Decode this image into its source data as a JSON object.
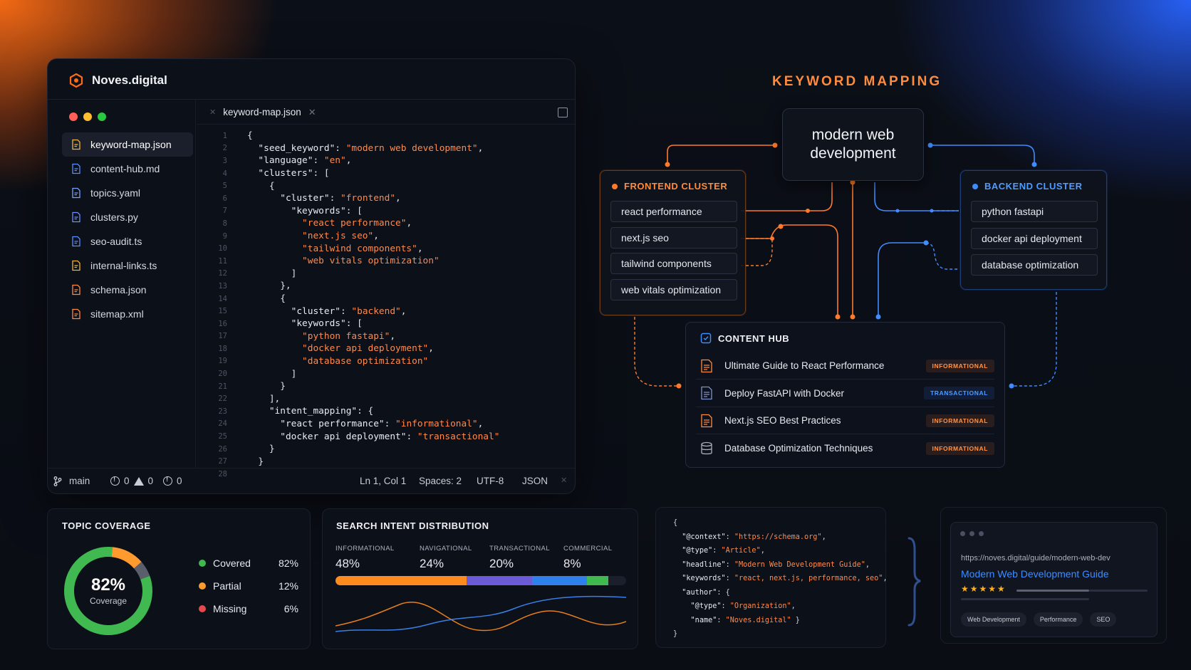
{
  "window": {
    "brand": "Noves.digital"
  },
  "sidebar": {
    "files": [
      {
        "name": "keyword-map.json",
        "icon": "json-file-icon",
        "color": "#f2b531",
        "active": true
      },
      {
        "name": "content-hub.md",
        "icon": "markdown-file-icon",
        "color": "#5a8dff"
      },
      {
        "name": "topics.yaml",
        "icon": "yaml-file-icon",
        "color": "#7aa0ff"
      },
      {
        "name": "clusters.py",
        "icon": "python-file-icon",
        "color": "#6c8cff"
      },
      {
        "name": "seo-audit.ts",
        "icon": "typescript-file-icon",
        "color": "#5a8dff"
      },
      {
        "name": "internal-links.ts",
        "icon": "link-file-icon",
        "color": "#f2b531"
      },
      {
        "name": "schema.json",
        "icon": "json-file-icon",
        "color": "#ff8a3d"
      },
      {
        "name": "sitemap.xml",
        "icon": "xml-file-icon",
        "color": "#ff8a3d"
      }
    ]
  },
  "editor": {
    "tab": "keyword-map.json",
    "lines": [
      {
        "n": "1",
        "t": "{"
      },
      {
        "n": "2",
        "t": "  \"seed_keyword\": \"modern web development\","
      },
      {
        "n": "3",
        "t": "  \"language\": \"en\","
      },
      {
        "n": "4",
        "t": "  \"clusters\": ["
      },
      {
        "n": "5",
        "t": "    {"
      },
      {
        "n": "6",
        "t": "      \"cluster\": \"frontend\","
      },
      {
        "n": "7",
        "t": "        \"keywords\": ["
      },
      {
        "n": "8",
        "t": "          \"react performance\","
      },
      {
        "n": "9",
        "t": "          \"next.js seo\","
      },
      {
        "n": "10",
        "t": "          \"tailwind components\","
      },
      {
        "n": "11",
        "t": "          \"web vitals optimization\""
      },
      {
        "n": "12",
        "t": "        ]"
      },
      {
        "n": "13",
        "t": "      },"
      },
      {
        "n": "14",
        "t": "      {"
      },
      {
        "n": "15",
        "t": "        \"cluster\": \"backend\","
      },
      {
        "n": "16",
        "t": "        \"keywords\": ["
      },
      {
        "n": "17",
        "t": "          \"python fastapi\","
      },
      {
        "n": "18",
        "t": "          \"docker api deployment\","
      },
      {
        "n": "19",
        "t": "          \"database optimization\""
      },
      {
        "n": "20",
        "t": "        ]"
      },
      {
        "n": "21",
        "t": "      }"
      },
      {
        "n": "22",
        "t": "    ],"
      },
      {
        "n": "23",
        "t": "    \"intent_mapping\": {"
      },
      {
        "n": "24",
        "t": "      \"react performance\": \"informational\","
      },
      {
        "n": "25",
        "t": "      \"docker api deployment\": \"transactional\""
      },
      {
        "n": "26",
        "t": "    }"
      },
      {
        "n": "27",
        "t": "  }"
      },
      {
        "n": "28",
        "t": ""
      }
    ]
  },
  "statusbar": {
    "branch": "main",
    "errors": "0",
    "warnings": "0",
    "info": "0",
    "position": "Ln 1, Col 1",
    "spaces": "Spaces: 2",
    "encoding": "UTF-8",
    "language": "JSON"
  },
  "mapping": {
    "title": "KEYWORD MAPPING",
    "seed_line1": "modern web",
    "seed_line2": "development",
    "frontend": {
      "title": "FRONTEND CLUSTER",
      "color": "#ff7a2a",
      "keywords": [
        "react performance",
        "next.js seo",
        "tailwind components",
        "web vitals optimization"
      ]
    },
    "backend": {
      "title": "BACKEND CLUSTER",
      "color": "#3f8cff",
      "keywords": [
        "python fastapi",
        "docker api deployment",
        "database optimization"
      ]
    },
    "hub": {
      "title": "CONTENT HUB",
      "items": [
        {
          "title": "Ultimate Guide to React Performance",
          "intent": "INFORMATIONAL",
          "icon": "article-icon"
        },
        {
          "title": "Deploy FastAPI with Docker",
          "intent": "TRANSACTIONAL",
          "icon": "document-icon"
        },
        {
          "title": "Next.js SEO Best Practices",
          "intent": "INFORMATIONAL",
          "icon": "chart-document-icon"
        },
        {
          "title": "Database Optimization Techniques",
          "intent": "INFORMATIONAL",
          "icon": "database-icon"
        }
      ]
    }
  },
  "coverage": {
    "title": "TOPIC COVERAGE",
    "value": "82%",
    "label": "Coverage",
    "segments": [
      {
        "name": "Covered",
        "value": 82,
        "pct": "82%",
        "color": "#3fb950"
      },
      {
        "name": "Partial",
        "value": 12,
        "pct": "12%",
        "color": "#ff9a2e"
      },
      {
        "name": "Missing",
        "value": 6,
        "pct": "6%",
        "color": "#e5484d"
      }
    ]
  },
  "intent": {
    "title": "SEARCH INTENT DISTRIBUTION",
    "items": [
      {
        "label": "INFORMATIONAL",
        "pct": "48%",
        "value": 48,
        "color": "#ff8a1e"
      },
      {
        "label": "NAVIGATIONAL",
        "pct": "24%",
        "value": 24,
        "color": "#6b5bd6"
      },
      {
        "label": "TRANSACTIONAL",
        "pct": "20%",
        "value": 20,
        "color": "#2f80ed"
      },
      {
        "label": "COMMERCIAL",
        "pct": "8%",
        "value": 8,
        "color": "#3fb950"
      }
    ]
  },
  "schema": {
    "lines": [
      "{",
      "  \"@context\": \"https://schema.org\",",
      "  \"@type\": \"Article\",",
      "  \"headline\": \"Modern Web Development Guide\",",
      "  \"keywords\": \"react, next.js, performance, seo\",",
      "  \"author\": {",
      "    \"@type\": \"Organization\",",
      "    \"name\": \"Noves.digital\" }",
      "}"
    ]
  },
  "serp": {
    "url": "https://noves.digital/guide/modern-web-dev",
    "title": "Modern Web Development Guide",
    "stars": "★★★★★",
    "tags": [
      "Web Development",
      "Performance",
      "SEO"
    ]
  }
}
